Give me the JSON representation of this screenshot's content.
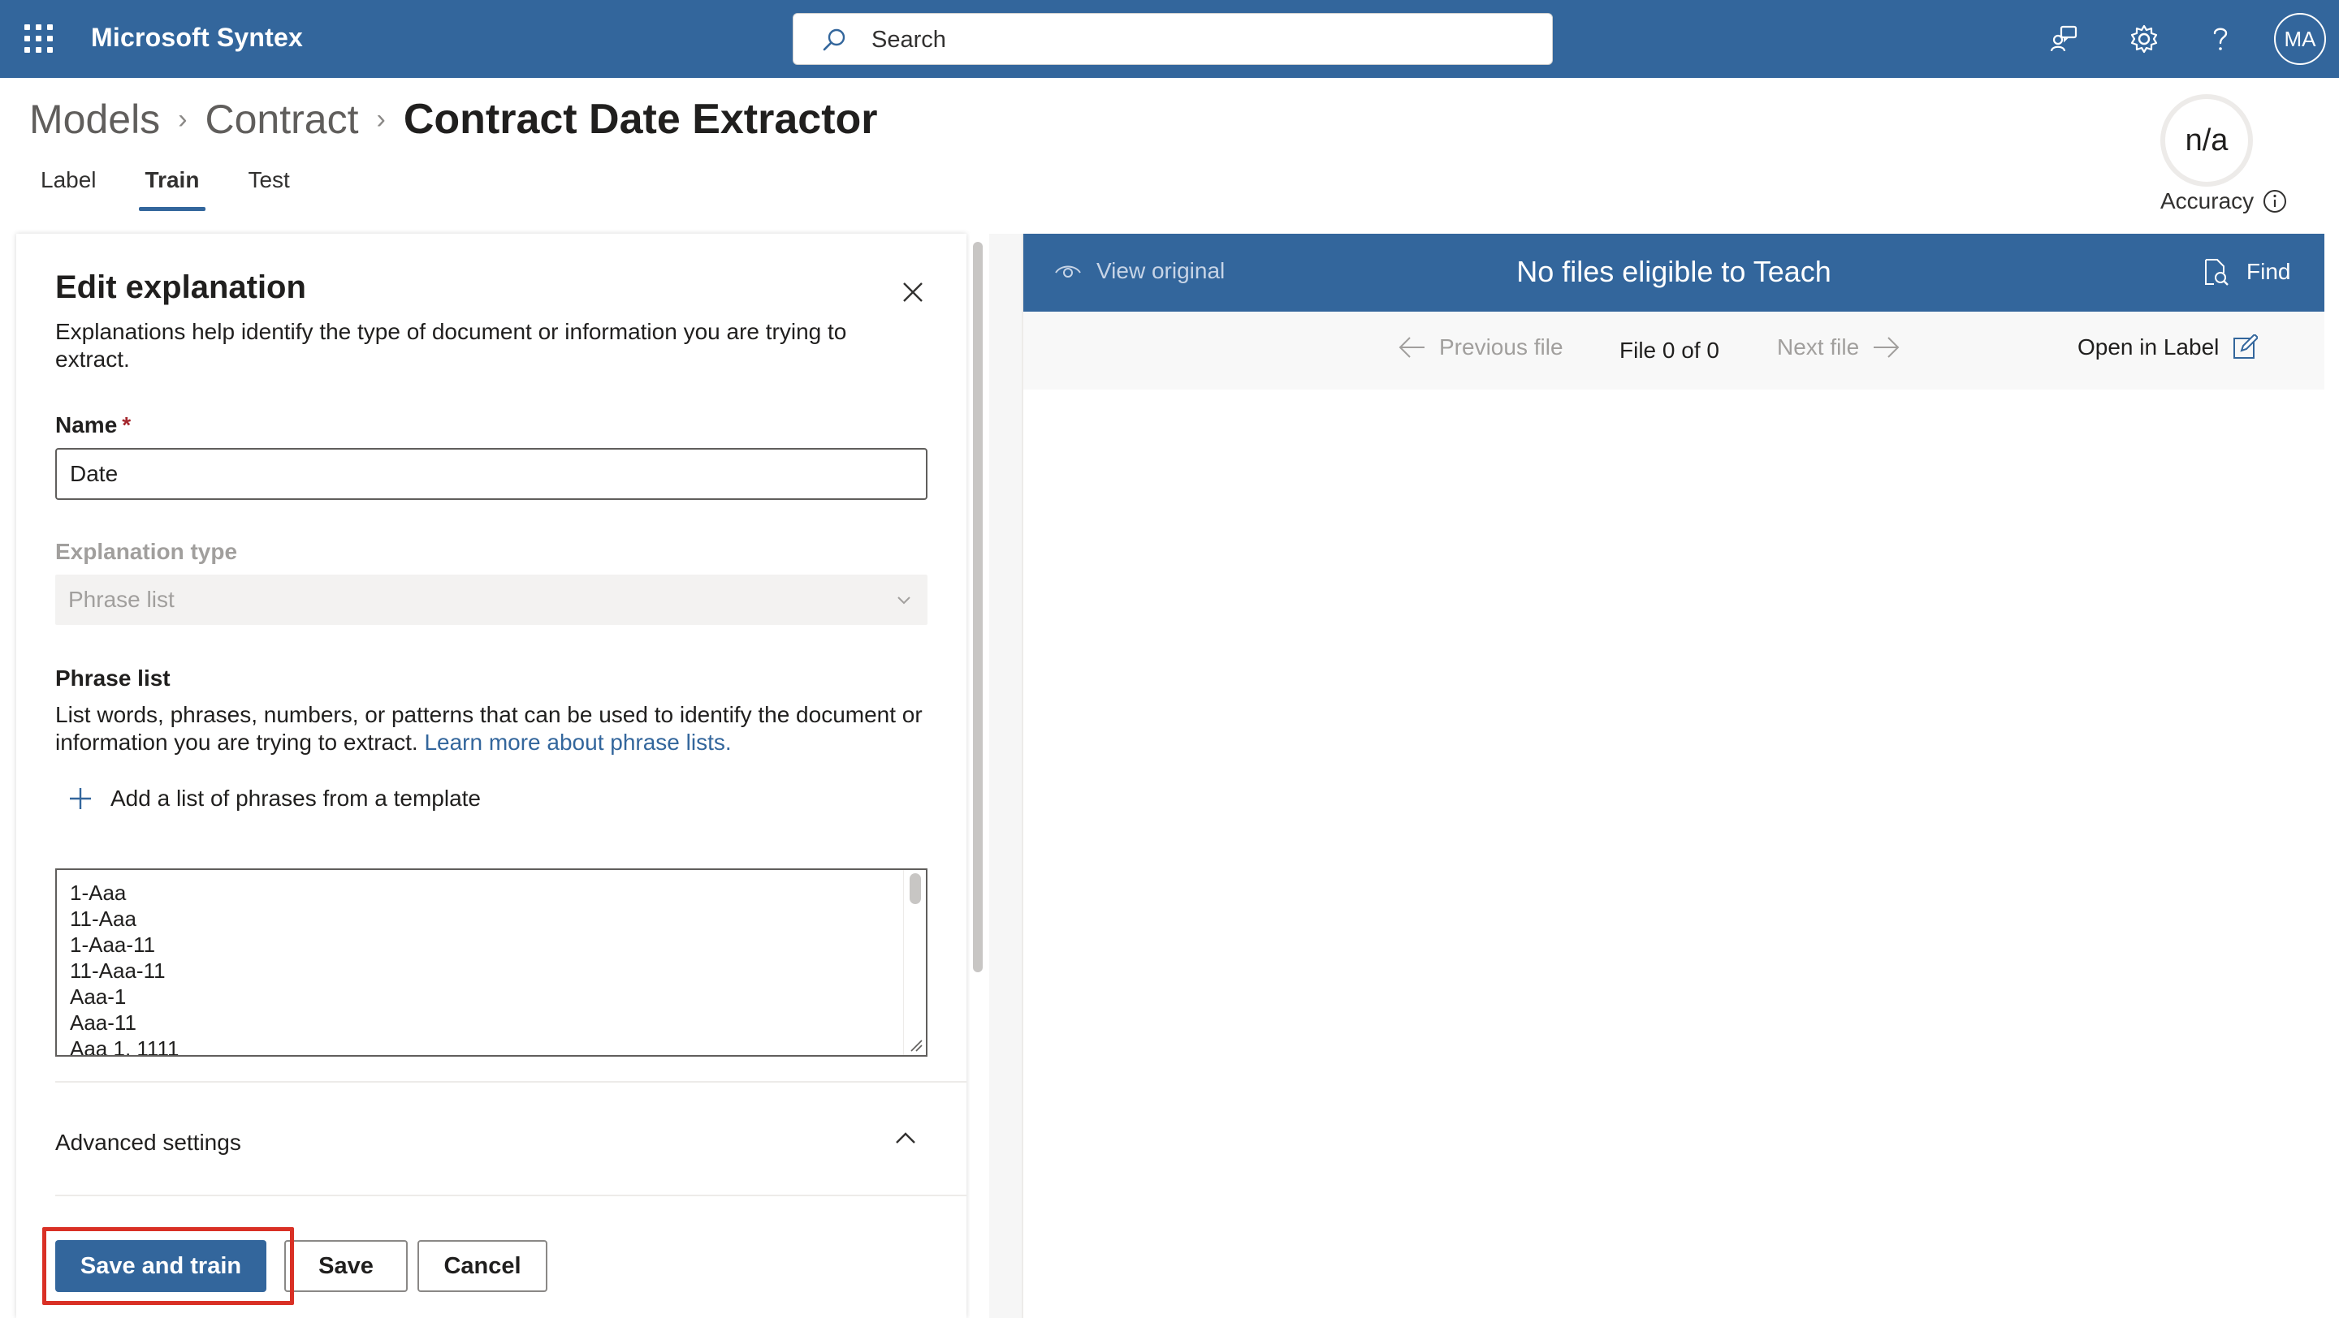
{
  "suitebar": {
    "app_name": "Microsoft Syntex",
    "search_placeholder": "Search",
    "avatar_initials": "MA",
    "icons": [
      "waffle-icon",
      "search-icon",
      "feedback-icon",
      "gear-icon",
      "help-icon"
    ]
  },
  "breadcrumb": {
    "items": [
      "Models",
      "Contract",
      "Contract Date Extractor"
    ]
  },
  "tabs": [
    {
      "label": "Label",
      "active": false
    },
    {
      "label": "Train",
      "active": true
    },
    {
      "label": "Test",
      "active": false
    }
  ],
  "accuracy": {
    "value": "n/a",
    "label": "Accuracy"
  },
  "edit_panel": {
    "title": "Edit explanation",
    "description": "Explanations help identify the type of document or information you are trying to extract.",
    "name_label": "Name",
    "required_marker": "*",
    "name_value": "Date",
    "explanation_type_label": "Explanation type",
    "explanation_type_value": "Phrase list",
    "phrase_list_label": "Phrase list",
    "phrase_list_desc": "List words, phrases, numbers, or patterns that can be used to identify the document or information you are trying to extract.",
    "phrase_list_link": "Learn more about phrase lists.",
    "add_template_label": "Add a list of phrases from a template",
    "phrases": [
      "1-Aaa",
      "11-Aaa",
      "1-Aaa-11",
      "11-Aaa-11",
      "Aaa-1",
      "Aaa-11",
      "Aaa 1, 1111"
    ],
    "advanced_settings_label": "Advanced settings",
    "buttons": {
      "save_and_train": "Save and train",
      "save": "Save",
      "cancel": "Cancel"
    }
  },
  "viewer": {
    "view_original": "View original",
    "status": "No files eligible to Teach",
    "find": "Find",
    "previous_file": "Previous file",
    "file_count": "File 0 of 0",
    "next_file": "Next file",
    "open_in_label": "Open in Label"
  },
  "colors": {
    "brand": "#33669c",
    "highlight": "#d93025"
  }
}
